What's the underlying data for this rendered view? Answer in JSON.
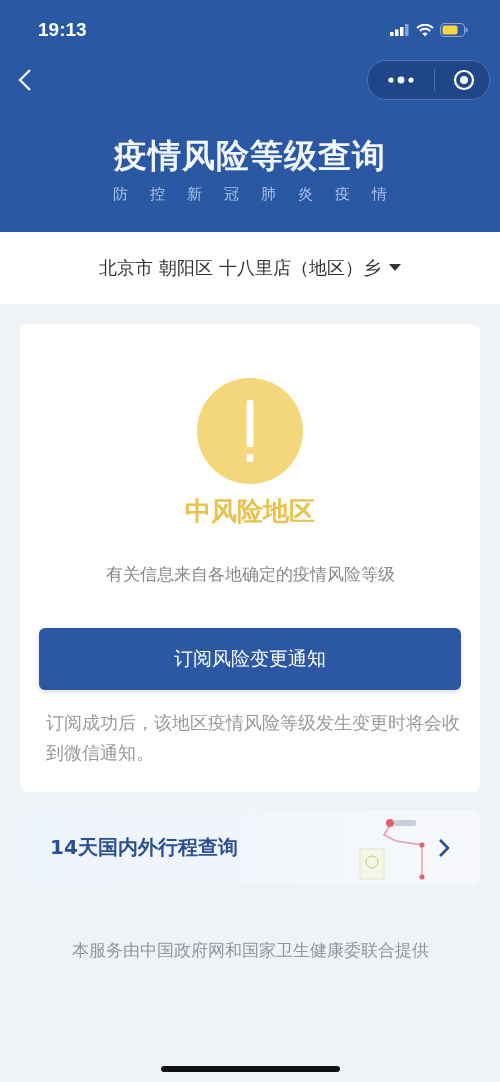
{
  "status_bar": {
    "time": "19:13"
  },
  "header": {
    "title": "疫情风险等级查询",
    "subtitle": [
      "防",
      "控",
      "新",
      "冠",
      "肺",
      "炎",
      "疫",
      "情"
    ]
  },
  "region_selector": {
    "value": "北京市 朝阳区 十八里店（地区）乡"
  },
  "result": {
    "kind": "medium",
    "level_text": "中风险地区",
    "info": "有关信息来自各地确定的疫情风险等级"
  },
  "subscribe_button": {
    "label": "订阅风险变更通知"
  },
  "subscribe_note": "订阅成功后，该地区疫情风险等级发生变更时将会收到微信通知。",
  "trip_card": {
    "title": "14天国内外行程查询"
  },
  "footer": "本服务由中国政府网和国家卫生健康委联合提供"
}
